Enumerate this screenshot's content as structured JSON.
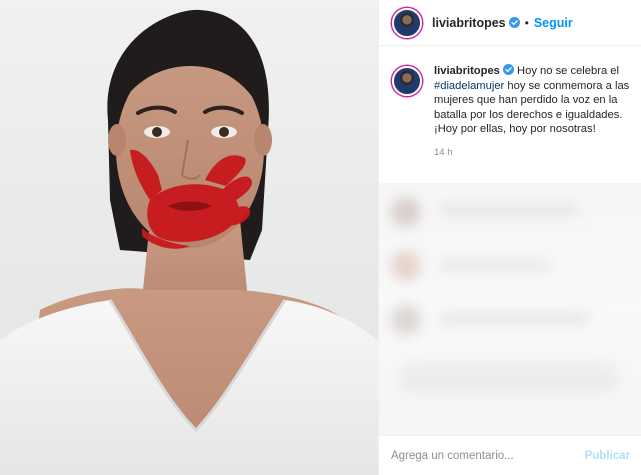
{
  "post": {
    "username": "liviabritopes",
    "follow_label": "Seguir",
    "separator": "•",
    "caption_prefix": "Hoy no se celebra el ",
    "hashtag": "#diadelamujer",
    "caption_suffix": " hoy se conmemora a las mujeres que han perdido la voz en la batalla por los derechos e igualdades. ¡Hoy por ellas, hoy por nosotras!",
    "time_ago": "14 h",
    "comment_placeholder": "Agrega un comentario...",
    "publish_label": "Publicar"
  },
  "colors": {
    "accent": "#0095f6",
    "verified": "#3897f0",
    "hand_paint": "#c8181c",
    "publish_disabled": "#b2dffc"
  },
  "icons": {
    "verified": "verified-badge-icon"
  }
}
